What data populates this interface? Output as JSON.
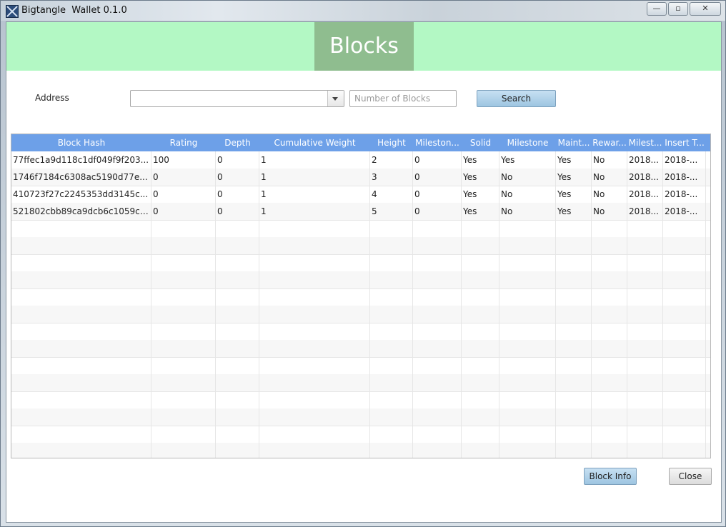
{
  "window": {
    "title": "Bigtangle  Wallet 0.1.0",
    "minimize": "—",
    "maximize": "▫",
    "close": "✕"
  },
  "banner": {
    "title": "Blocks"
  },
  "form": {
    "address_label": "Address",
    "address_value": "",
    "blocks_placeholder": "Number of Blocks",
    "search_label": "Search"
  },
  "table": {
    "columns": [
      "Block Hash",
      "Rating",
      "Depth",
      "Cumulative Weight",
      "Height",
      "Mileston...",
      "Solid",
      "Milestone",
      "Maint...",
      "Rewar...",
      "Milest...",
      "Insert T..."
    ],
    "rows": [
      [
        "77ffec1a9d118c1df049f9f203...",
        "100",
        "0",
        "1",
        "2",
        "0",
        "Yes",
        "Yes",
        "Yes",
        "No",
        "2018...",
        "2018-..."
      ],
      [
        "1746f7184c6308ac5190d77e...",
        "0",
        "0",
        "1",
        "3",
        "0",
        "Yes",
        "No",
        "Yes",
        "No",
        "2018...",
        "2018-..."
      ],
      [
        "410723f27c2245353dd3145c...",
        "0",
        "0",
        "1",
        "4",
        "0",
        "Yes",
        "No",
        "Yes",
        "No",
        "2018...",
        "2018-..."
      ],
      [
        "521802cbb89ca9dcb6c1059ca...",
        "0",
        "0",
        "1",
        "5",
        "0",
        "Yes",
        "No",
        "Yes",
        "No",
        "2018...",
        "2018-..."
      ]
    ],
    "empty_rows": 14
  },
  "footer": {
    "block_info_label": "Block Info",
    "close_label": "Close"
  },
  "colors": {
    "banner_bg": "#b3f8c4",
    "banner_title_bg": "#8fbd8f",
    "header_bg": "#6da0e8",
    "button_bg": "#a7cbe5"
  }
}
